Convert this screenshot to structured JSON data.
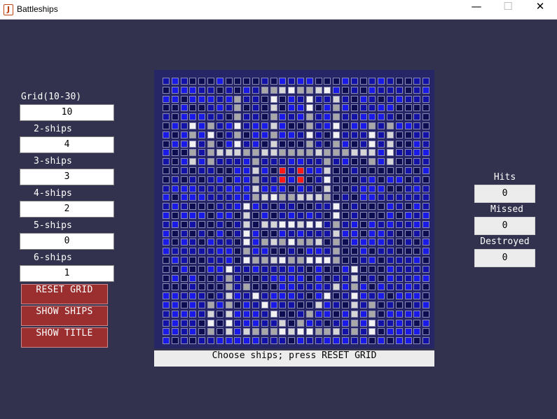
{
  "window": {
    "title": "Battleships",
    "icon": "java-cup-icon"
  },
  "controls": {
    "grid_label": "Grid(10-30)",
    "grid_value": "10",
    "ships2_label": "2-ships",
    "ships2_value": "4",
    "ships3_label": "3-ships",
    "ships3_value": "3",
    "ships4_label": "4-ships",
    "ships4_value": "2",
    "ships5_label": "5-ships",
    "ships5_value": "0",
    "ships6_label": "6-ships",
    "ships6_value": "1"
  },
  "buttons": {
    "reset": "RESET GRID",
    "show_ships": "SHOW SHIPS",
    "show_title": "SHOW TITLE"
  },
  "stats": {
    "hits_label": "Hits",
    "hits": "0",
    "missed_label": "Missed",
    "missed": "0",
    "destroyed_label": "Destroyed",
    "destroyed": "0"
  },
  "status_text": "Choose ships; press RESET GRID",
  "board": {
    "size": 30,
    "colors": {
      "ocean_bright": "#1a1ae8",
      "ocean_mid": "#1212a8",
      "ocean_dark": "#0d0d52",
      "title_light": "#d6d6d6",
      "title_white": "#f2f2f2",
      "title_grey": "#a8a8a8",
      "hit_red": "#ff1a1a",
      "background": "#262667"
    }
  }
}
